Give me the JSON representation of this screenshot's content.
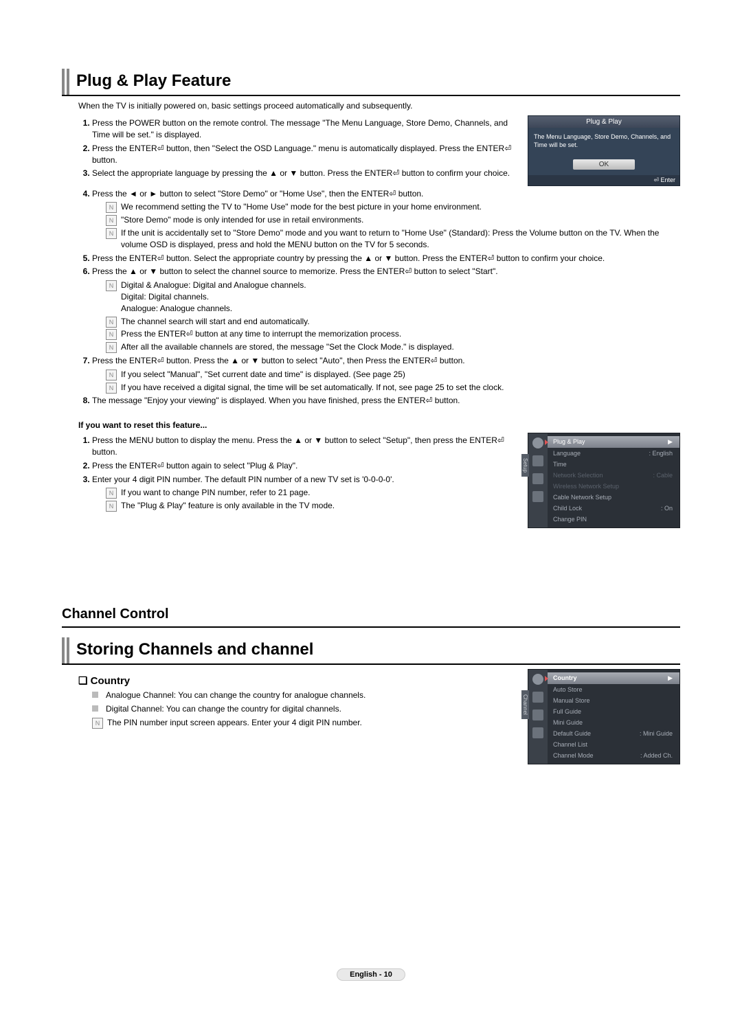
{
  "titles": {
    "plug_play": "Plug & Play Feature",
    "channel_control": "Channel Control",
    "storing": "Storing Channels and channel"
  },
  "intro": "When the TV is initially powered on, basic settings proceed automatically and subsequently.",
  "steps": {
    "s1": "Press the POWER button on the remote control. The message \"The Menu Language, Store Demo, Channels, and Time will be set.\" is displayed.",
    "s2": "Press the ENTER⏎ button, then \"Select the OSD Language.\" menu is automatically displayed. Press the ENTER⏎ button.",
    "s3": "Select the appropriate language by pressing the ▲ or ▼ button. Press the ENTER⏎ button to confirm your choice.",
    "s4": "Press the ◄ or ► button to select \"Store Demo\" or \"Home Use\", then the ENTER⏎ button.",
    "s4_n1": "We recommend setting the TV to \"Home Use\" mode for the best picture in your home environment.",
    "s4_n2": "\"Store Demo\" mode is only intended for use in retail environments.",
    "s4_n3": "If the unit is accidentally set to \"Store Demo\" mode and you want to return to \"Home Use\" (Standard): Press the Volume button on the TV. When the volume OSD is displayed, press and hold the MENU button on the TV for 5 seconds.",
    "s5": "Press the ENTER⏎ button. Select the appropriate country by pressing the ▲ or ▼ button. Press the ENTER⏎ button to confirm your choice.",
    "s6": "Press the ▲ or ▼ button to select the channel source to memorize. Press the ENTER⏎ button to select \"Start\".",
    "s6_n1a": "Digital & Analogue: Digital and Analogue channels.",
    "s6_n1b": "Digital: Digital channels.",
    "s6_n1c": "Analogue: Analogue channels.",
    "s6_n2": "The channel search will start and end automatically.",
    "s6_n3": "Press the ENTER⏎ button at any time to interrupt the memorization process.",
    "s6_n4": "After all the available channels are stored, the message \"Set the Clock Mode.\" is displayed.",
    "s7": "Press the ENTER⏎ button. Press the ▲ or ▼ button to select \"Auto\", then Press the ENTER⏎ button.",
    "s7_n1": "If you select \"Manual\", \"Set current date and time\" is displayed. (See page 25)",
    "s7_n2": "If you have received a digital signal, the time will be set automatically. If not, see page 25 to set the clock.",
    "s8": "The message \"Enjoy your viewing\" is displayed. When you have finished, press the ENTER⏎ button."
  },
  "reset_heading": "If you want to reset this feature...",
  "reset": {
    "r1": "Press the MENU button to display the menu. Press the ▲ or ▼ button to select \"Setup\", then press the ENTER⏎ button.",
    "r2": "Press the ENTER⏎ button again to select \"Plug & Play\".",
    "r3": "Enter your 4 digit PIN number. The default PIN number of a new TV set is '0-0-0-0'.",
    "r3_n1": "If you want to change PIN number, refer to 21 page.",
    "r3_n2": "The \"Plug & Play\" feature is only available in the TV mode."
  },
  "country_heading": "Country",
  "country": {
    "c1": "Analogue Channel: You can change the country for analogue channels.",
    "c2": "Digital Channel: You can change the country for digital channels.",
    "c_n": "The PIN number input screen appears. Enter your 4 digit PIN number."
  },
  "dialog": {
    "title": "Plug & Play",
    "msg": "The Menu Language, Store Demo, Channels, and Time will be set.",
    "ok": "OK",
    "enter": "⏎ Enter"
  },
  "setup_menu": {
    "vlabel": "Setup",
    "items": {
      "pp": "Plug & Play",
      "lang": "Language",
      "lang_v": ": English",
      "time": "Time",
      "net_sel": "Network Selection",
      "net_sel_v": ": Cable",
      "wifi": "Wireless Network Setup",
      "cable": "Cable Network Setup",
      "child": "Child Lock",
      "child_v": ": On",
      "pin": "Change PIN"
    }
  },
  "channel_menu": {
    "vlabel": "Channel",
    "items": {
      "country": "Country",
      "auto": "Auto Store",
      "manual": "Manual Store",
      "full": "Full Guide",
      "mini": "Mini Guide",
      "def": "Default Guide",
      "def_v": ": Mini Guide",
      "list": "Channel List",
      "mode": "Channel Mode",
      "mode_v": ": Added Ch."
    }
  },
  "footer": "English - 10"
}
